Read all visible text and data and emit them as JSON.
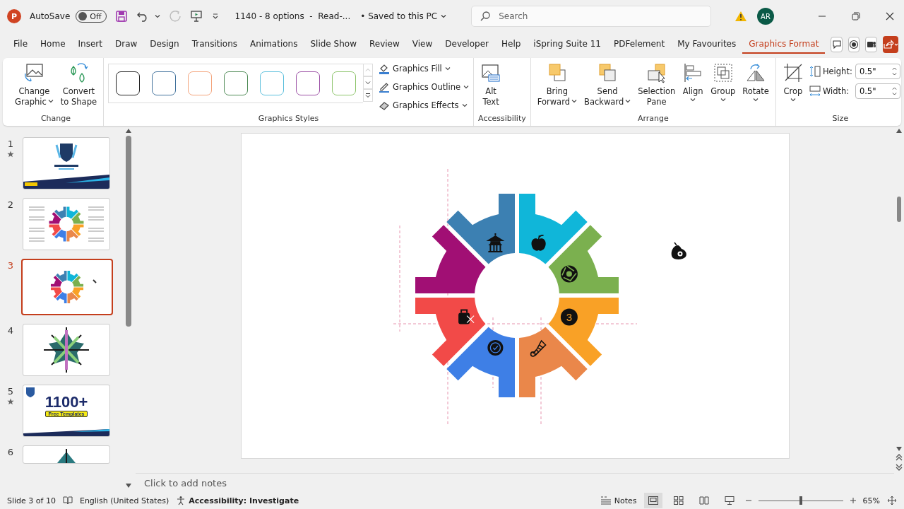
{
  "app": {
    "logo_letter": "P",
    "autosave": {
      "label": "AutoSave",
      "state": "Off",
      "on": false
    },
    "document_title": "1140 - 8 options  -  Read-...",
    "save_status": "• Saved to this PC",
    "search": {
      "placeholder": "Search"
    },
    "avatar": "AR"
  },
  "tabs": [
    {
      "label": "File",
      "selected": false
    },
    {
      "label": "Home",
      "selected": false
    },
    {
      "label": "Insert",
      "selected": false
    },
    {
      "label": "Draw",
      "selected": false
    },
    {
      "label": "Design",
      "selected": false
    },
    {
      "label": "Transitions",
      "selected": false
    },
    {
      "label": "Animations",
      "selected": false
    },
    {
      "label": "Slide Show",
      "selected": false
    },
    {
      "label": "Review",
      "selected": false
    },
    {
      "label": "View",
      "selected": false
    },
    {
      "label": "Developer",
      "selected": false
    },
    {
      "label": "Help",
      "selected": false
    },
    {
      "label": "iSpring Suite 11",
      "selected": false
    },
    {
      "label": "PDFelement",
      "selected": false
    },
    {
      "label": "My Favourites",
      "selected": false
    },
    {
      "label": "Graphics Format",
      "selected": true
    }
  ],
  "ribbon": {
    "change": {
      "label": "Change",
      "change_graphic": [
        "Change",
        "Graphic"
      ],
      "convert": [
        "Convert",
        "to Shape"
      ]
    },
    "styles": {
      "label": "Graphics Styles",
      "swatches": [
        {
          "color": "#222222"
        },
        {
          "color": "#41719c"
        },
        {
          "color": "#f4a47c"
        },
        {
          "color": "#4e8a55"
        },
        {
          "color": "#5bbfdc"
        },
        {
          "color": "#9b4fa5"
        },
        {
          "color": "#8cc46a"
        }
      ],
      "commands": [
        "Graphics Fill",
        "Graphics Outline",
        "Graphics Effects"
      ]
    },
    "accessibility": {
      "label": "Accessibility",
      "alt_text": [
        "Alt",
        "Text"
      ]
    },
    "arrange": {
      "label": "Arrange",
      "bring_forward": [
        "Bring",
        "Forward"
      ],
      "send_backward": [
        "Send",
        "Backward"
      ],
      "selection_pane": [
        "Selection",
        "Pane"
      ],
      "align": "Align",
      "group": "Group",
      "rotate": "Rotate"
    },
    "size": {
      "label": "Size",
      "crop": "Crop",
      "height": {
        "label": "Height:",
        "value": "0.5\""
      },
      "width": {
        "label": "Width:",
        "value": "0.5\""
      }
    }
  },
  "slides": [
    {
      "number": "1",
      "starred": true,
      "selected": false,
      "kind": "title"
    },
    {
      "number": "2",
      "starred": false,
      "selected": false,
      "kind": "geartext"
    },
    {
      "number": "3",
      "starred": false,
      "selected": true,
      "kind": "gear"
    },
    {
      "number": "4",
      "starred": false,
      "selected": false,
      "kind": "star"
    },
    {
      "number": "5",
      "starred": true,
      "selected": false,
      "kind": "promo",
      "headline": "1100+",
      "banner": "Free Templates"
    },
    {
      "number": "6",
      "starred": false,
      "selected": false,
      "kind": "partial"
    }
  ],
  "gear": {
    "segments": [
      {
        "color": "#10b6d9"
      },
      {
        "color": "#7bb04f"
      },
      {
        "color": "#f9a126",
        "badge": "3"
      },
      {
        "color": "#ea874a"
      },
      {
        "color": "#3e7fe6"
      },
      {
        "color": "#f24a48"
      },
      {
        "color": "#a10f74"
      },
      {
        "color": "#3c80b2"
      }
    ]
  },
  "notes_placeholder": "Click to add notes",
  "status_bar": {
    "slide": "Slide 3 of 10",
    "language": "English (United States)",
    "accessibility": "Accessibility: Investigate",
    "notes": "Notes",
    "zoom": {
      "level": 0.5,
      "reading": "65%"
    }
  }
}
